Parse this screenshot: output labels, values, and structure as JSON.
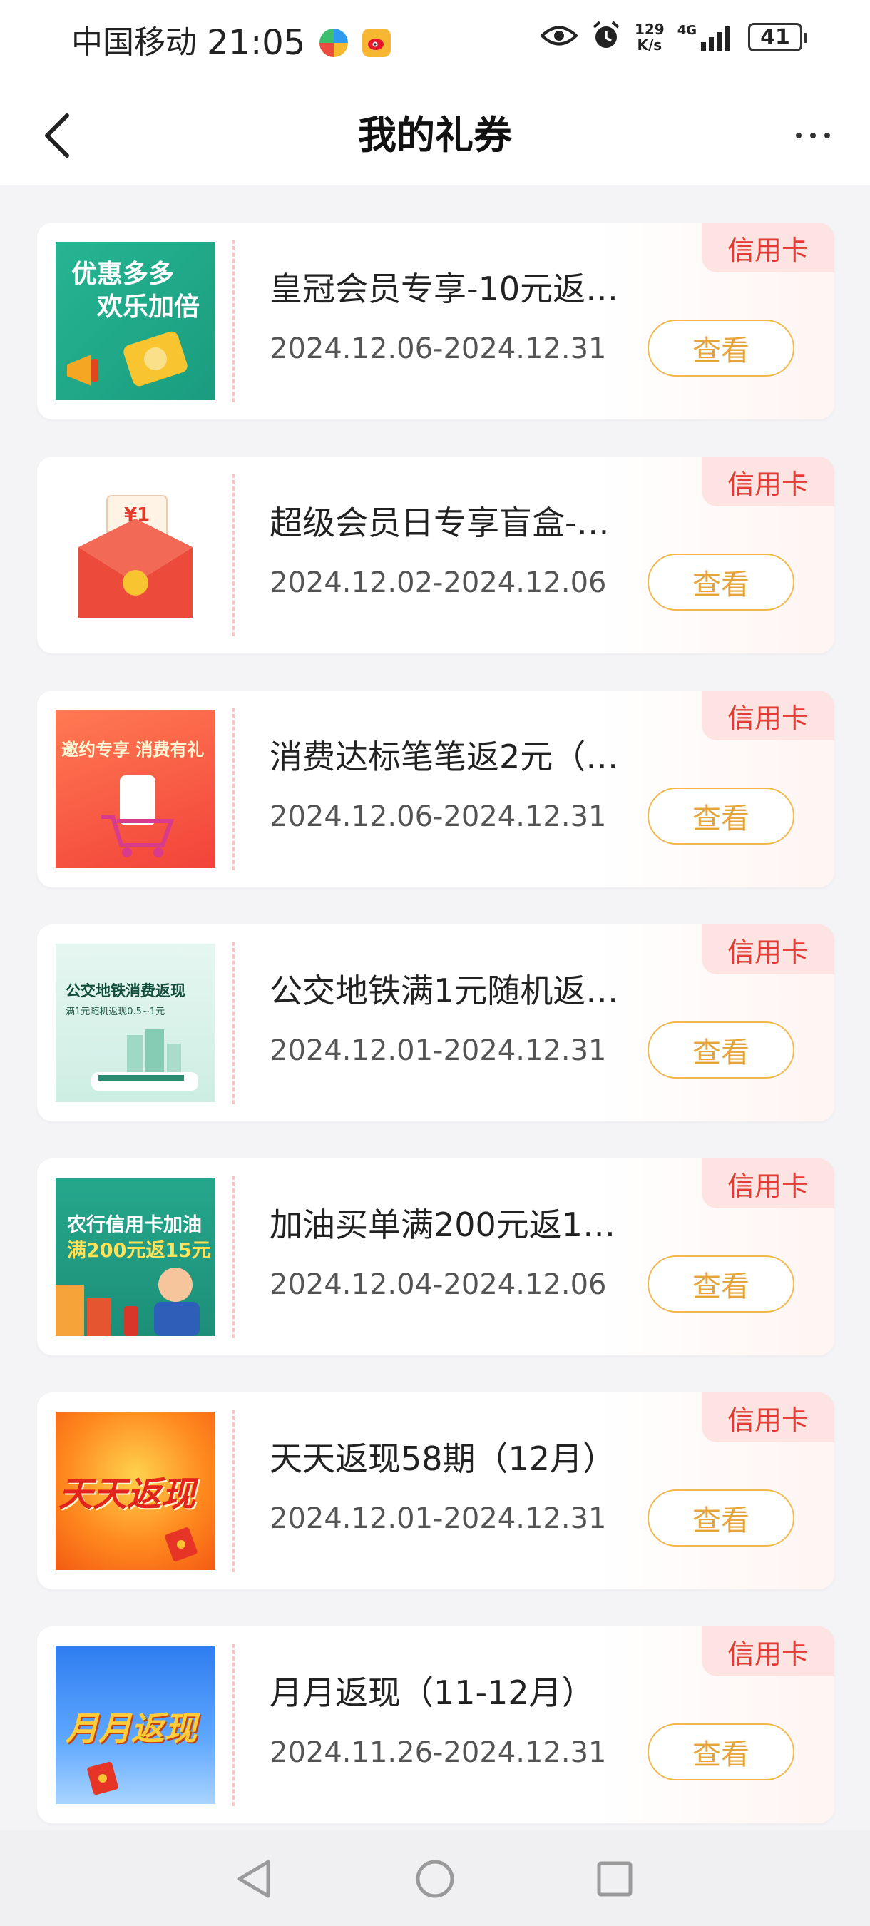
{
  "status_bar": {
    "carrier": "中国移动",
    "time": "21:05",
    "net_speed_value": "129",
    "net_speed_unit": "K/s",
    "network_type": "4G",
    "battery": "41"
  },
  "header": {
    "title": "我的礼券"
  },
  "coupons": [
    {
      "tag": "信用卡",
      "title": "皇冠会员专享-10元返…",
      "dates": "2024.12.06-2024.12.31",
      "button": "查看",
      "thumb_text": [
        "优惠多多",
        "欢乐加倍"
      ]
    },
    {
      "tag": "信用卡",
      "title": "超级会员日专享盲盒-…",
      "dates": "2024.12.02-2024.12.06",
      "button": "查看",
      "thumb_text": [
        "¥1"
      ]
    },
    {
      "tag": "信用卡",
      "title": "消费达标笔笔返2元（…",
      "dates": "2024.12.06-2024.12.31",
      "button": "查看",
      "thumb_text": [
        "邀约专享 消费有礼"
      ]
    },
    {
      "tag": "信用卡",
      "title": "公交地铁满1元随机返…",
      "dates": "2024.12.01-2024.12.31",
      "button": "查看",
      "thumb_text": [
        "公交地铁消费返现",
        "满1元随机返现0.5~1元"
      ]
    },
    {
      "tag": "信用卡",
      "title": "加油买单满200元返1…",
      "dates": "2024.12.04-2024.12.06",
      "button": "查看",
      "thumb_text": [
        "农行信用卡加油",
        "满200元返15元"
      ]
    },
    {
      "tag": "信用卡",
      "title": "天天返现58期（12月）",
      "dates": "2024.12.01-2024.12.31",
      "button": "查看",
      "thumb_text": [
        "天天返现"
      ]
    },
    {
      "tag": "信用卡",
      "title": "月月返现（11-12月）",
      "dates": "2024.11.26-2024.12.31",
      "button": "查看",
      "thumb_text": [
        "月月返现"
      ]
    }
  ],
  "colors": {
    "tag_bg": "#fde4e2",
    "tag_text": "#e43b34",
    "button_border": "#f2b84c",
    "button_text": "#e5a43a"
  }
}
